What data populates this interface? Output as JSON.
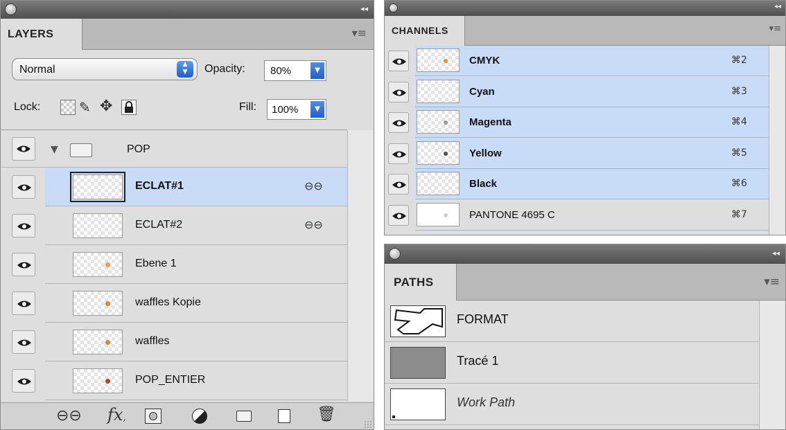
{
  "layers_panel": {
    "tab_label": "LAYERS",
    "blend_mode": "Normal",
    "opacity_label": "Opacity:",
    "opacity_value": "80%",
    "lock_label": "Lock:",
    "fill_label": "Fill:",
    "fill_value": "100%",
    "group": {
      "name": "POP",
      "expanded": true
    },
    "layers": [
      {
        "name": "ECLAT#1",
        "selected": true,
        "linked": true,
        "bold": true,
        "thumb_dot": ""
      },
      {
        "name": "ECLAT#2",
        "selected": false,
        "linked": true,
        "bold": false,
        "thumb_dot": ""
      },
      {
        "name": "Ebene 1",
        "selected": false,
        "linked": false,
        "bold": false,
        "thumb_dot": "#f0a040"
      },
      {
        "name": "waffles Kopie",
        "selected": false,
        "linked": false,
        "bold": false,
        "thumb_dot": "#e8822a"
      },
      {
        "name": "waffles",
        "selected": false,
        "linked": false,
        "bold": false,
        "thumb_dot": "#e8822a"
      },
      {
        "name": "POP_ENTIER",
        "selected": false,
        "linked": false,
        "bold": false,
        "thumb_dot": "#c0401a"
      }
    ],
    "footer_icons": [
      "link-layers-icon",
      "fx-icon",
      "layer-mask-icon",
      "adjustment-layer-icon",
      "new-group-icon",
      "new-layer-icon",
      "trash-icon"
    ]
  },
  "channels_panel": {
    "tab_label": "CHANNELS",
    "channels": [
      {
        "name": "CMYK",
        "shortcut": "⌘2",
        "selected": true,
        "bold": true,
        "thumb_dot": "#f08a30",
        "plain_thumb": false
      },
      {
        "name": "Cyan",
        "shortcut": "⌘3",
        "selected": true,
        "bold": true,
        "thumb_dot": "",
        "plain_thumb": false
      },
      {
        "name": "Magenta",
        "shortcut": "⌘4",
        "selected": true,
        "bold": true,
        "thumb_dot": "#9a9a9a",
        "plain_thumb": false
      },
      {
        "name": "Yellow",
        "shortcut": "⌘5",
        "selected": true,
        "bold": true,
        "thumb_dot": "#505050",
        "plain_thumb": false
      },
      {
        "name": "Black",
        "shortcut": "⌘6",
        "selected": true,
        "bold": true,
        "thumb_dot": "",
        "plain_thumb": false
      },
      {
        "name": "PANTONE 4695 C",
        "shortcut": "⌘7",
        "selected": false,
        "bold": false,
        "thumb_dot": "#cfcfcf",
        "plain_thumb": true
      }
    ]
  },
  "paths_panel": {
    "tab_label": "PATHS",
    "paths": [
      {
        "name": "FORMAT",
        "italic": false,
        "thumb": "outline-shape"
      },
      {
        "name": "Tracé 1",
        "italic": false,
        "thumb": "gray-fill"
      },
      {
        "name": "Work Path",
        "italic": true,
        "thumb": "white"
      }
    ]
  },
  "colors": {
    "selection": "#c8dcf7",
    "panel_bg": "#dedede",
    "titlebar": "#5f5f5f",
    "dropdown_blue": "#2f74d8"
  }
}
